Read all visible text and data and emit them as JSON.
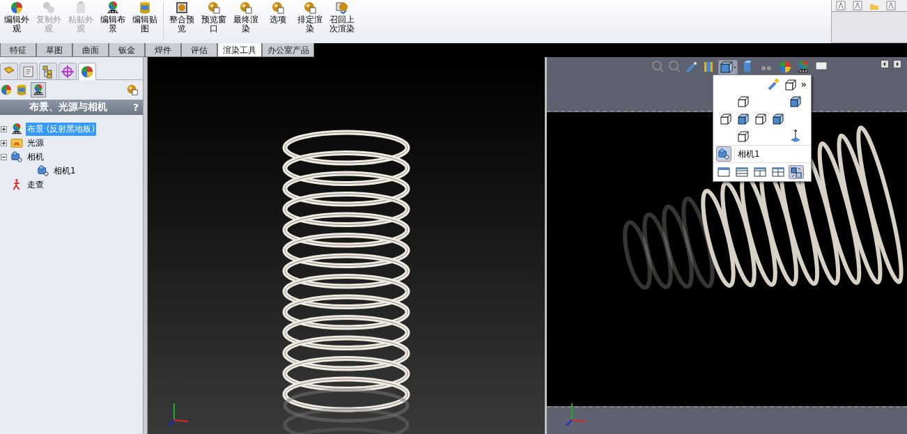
{
  "toolbar": {
    "groups": [
      [
        {
          "label": "编辑外观",
          "disabled": false
        },
        {
          "label": "复制外观",
          "disabled": true
        },
        {
          "label": "粘贴外观",
          "disabled": true
        },
        {
          "label": "编辑布景",
          "disabled": false
        },
        {
          "label": "编辑贴图",
          "disabled": false
        }
      ],
      [
        {
          "label": "整合预览",
          "disabled": false
        },
        {
          "label": "预览窗口",
          "disabled": false
        },
        {
          "label": "最终渲染",
          "disabled": false
        },
        {
          "label": "选项",
          "disabled": false
        },
        {
          "label": "排定渲染",
          "disabled": false
        },
        {
          "label": "召回上次渲染",
          "disabled": false
        }
      ]
    ]
  },
  "command_tabs": [
    {
      "label": "特征",
      "selected": false
    },
    {
      "label": "草图",
      "selected": false
    },
    {
      "label": "曲面",
      "selected": false
    },
    {
      "label": "钣金",
      "selected": false
    },
    {
      "label": "焊件",
      "selected": false
    },
    {
      "label": "评估",
      "selected": false
    },
    {
      "label": "渲染工具",
      "selected": true
    },
    {
      "label": "办公室产品",
      "selected": false
    }
  ],
  "panel": {
    "tabs": [
      {
        "selected": false
      },
      {
        "selected": false
      },
      {
        "selected": false
      },
      {
        "selected": false
      },
      {
        "selected": true
      }
    ],
    "title": "布景、光源与相机",
    "help": "?",
    "tree": [
      {
        "label": "布景 (反射黑地板)",
        "selected": true,
        "expanded": false
      },
      {
        "label": "光源",
        "selected": false,
        "expanded": false
      },
      {
        "label": "相机",
        "selected": false,
        "expanded": true,
        "children": [
          {
            "label": "相机1",
            "selected": false
          }
        ]
      },
      {
        "label": "走查",
        "selected": false
      }
    ]
  },
  "view_popup": {
    "more": "»",
    "camera": "相机1",
    "layouts": [
      {
        "selected": false
      },
      {
        "selected": false
      },
      {
        "selected": false
      },
      {
        "selected": false
      },
      {
        "selected": true
      }
    ]
  }
}
